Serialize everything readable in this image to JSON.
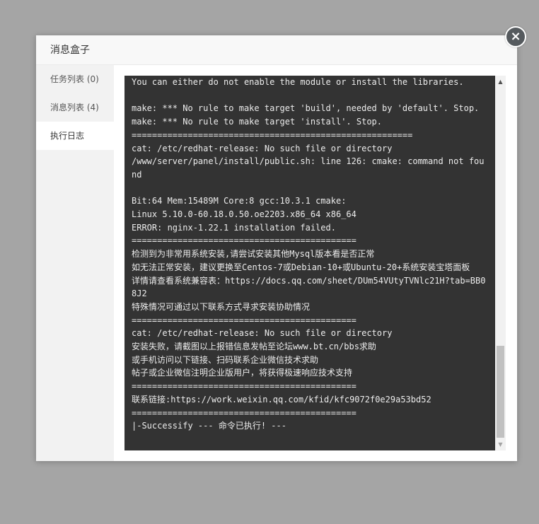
{
  "dialog": {
    "title": "消息盒子",
    "close_icon": "×"
  },
  "sidebar": {
    "items": [
      {
        "label": "任务列表 (0)"
      },
      {
        "label": "消息列表 (4)"
      },
      {
        "label": "执行日志"
      }
    ],
    "active_index": 2
  },
  "log": {
    "text": "You can either do not enable the module or install the libraries.\n\nmake: *** No rule to make target 'build', needed by 'default'. Stop.\nmake: *** No rule to make target 'install'. Stop.\n=======================================================\ncat: /etc/redhat-release: No such file or directory\n/www/server/panel/install/public.sh: line 126: cmake: command not found\n\nBit:64 Mem:15489M Core:8 gcc:10.3.1 cmake:\nLinux 5.10.0-60.18.0.50.oe2203.x86_64 x86_64\nERROR: nginx-1.22.1 installation failed.\n============================================\n检测到为非常用系统安装,请尝试安装其他Mysql版本看是否正常\n如无法正常安装，建议更换至Centos-7或Debian-10+或Ubuntu-20+系统安装宝塔面板\n详情请查看系统兼容表：https://docs.qq.com/sheet/DUm54VUtyTVNlc21H?tab=BB08J2\n特殊情况可通过以下联系方式寻求安装协助情况\n============================================\ncat: /etc/redhat-release: No such file or directory\n安装失败，请截图以上报错信息发帖至论坛www.bt.cn/bbs求助\n或手机访问以下链接、扫码联系企业微信技术求助\n帖子或企业微信注明企业版用户，将获得极速响应技术支持\n============================================\n联系链接:https://work.weixin.qq.com/kfid/kfc9072f0e29a53bd52\n============================================\n|-Successify --- 命令已执行! ---"
  },
  "scrollbar": {
    "up_arrow": "▲",
    "down_arrow": "▼"
  }
}
